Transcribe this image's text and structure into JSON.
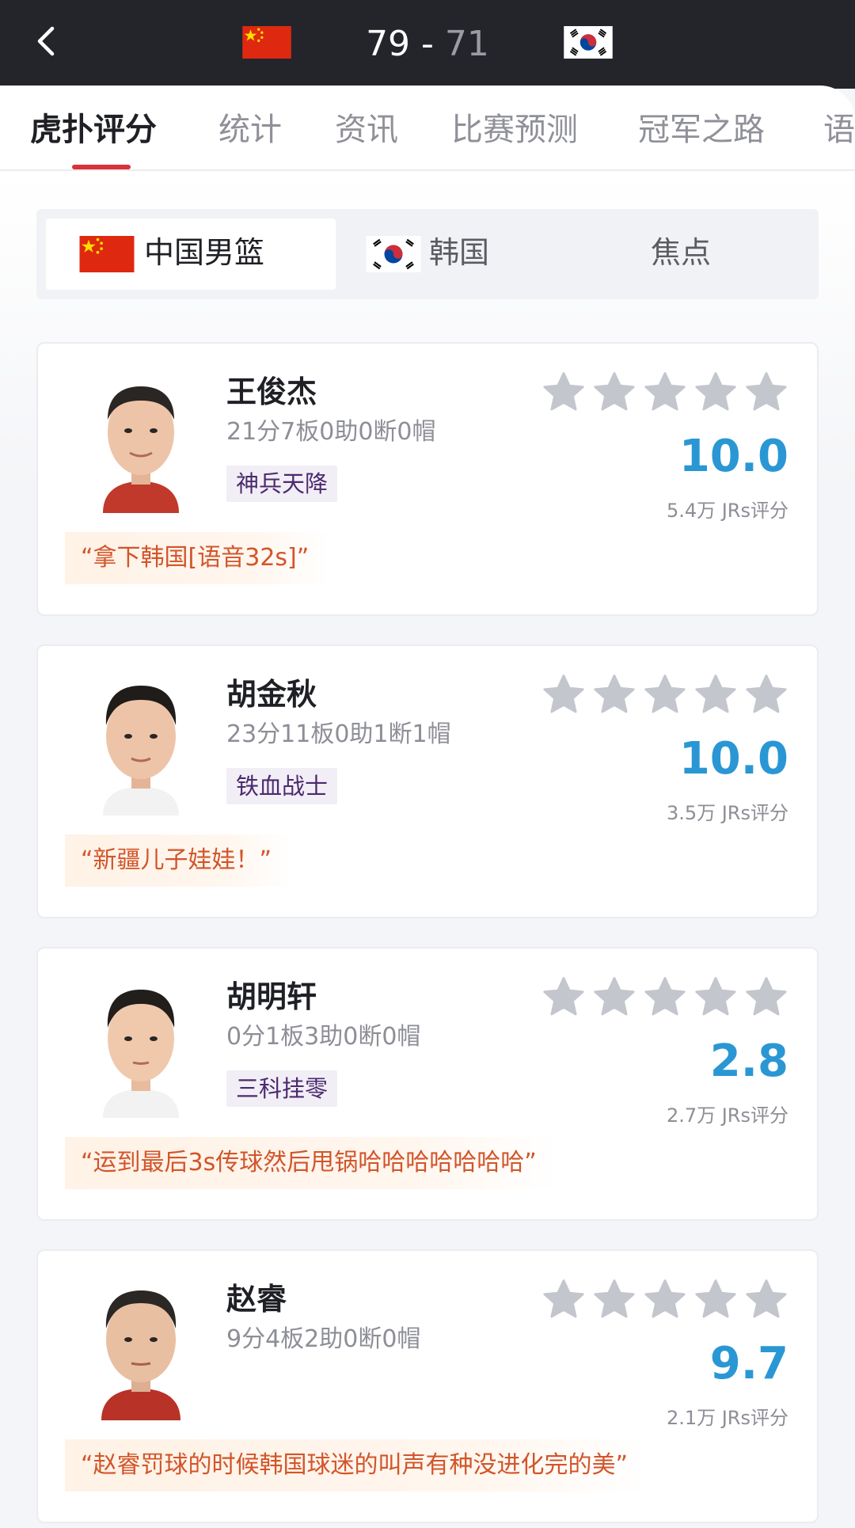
{
  "header": {
    "score_home": "79",
    "score_sep": " - ",
    "score_away": "71",
    "home_flag": "china-flag",
    "away_flag": "south-korea-flag"
  },
  "tabs": [
    {
      "label": "虎扑评分",
      "active": true
    },
    {
      "label": "统计"
    },
    {
      "label": "资讯"
    },
    {
      "label": "比赛预测"
    },
    {
      "label": "冠军之路"
    },
    {
      "label": "语"
    }
  ],
  "segment": {
    "items": [
      {
        "label": "中国男篮",
        "active": true,
        "icon": "china-flag"
      },
      {
        "label": "韩国",
        "icon": "south-korea-flag"
      },
      {
        "label": "焦点"
      }
    ]
  },
  "players": [
    {
      "name": "王俊杰",
      "stats": "21分7板0助0断0帽",
      "badge": "神兵天降",
      "rating": "10.0",
      "votes": "5.4万 JRs评分",
      "quote": "“拿下韩国[语音32s]”"
    },
    {
      "name": "胡金秋",
      "stats": "23分11板0助1断1帽",
      "badge": "铁血战士",
      "rating": "10.0",
      "votes": "3.5万 JRs评分",
      "quote": "“新疆儿子娃娃！”"
    },
    {
      "name": "胡明轩",
      "stats": "0分1板3助0断0帽",
      "badge": "三科挂零",
      "rating": "2.8",
      "votes": "2.7万 JRs评分",
      "quote": "“运到最后3s传球然后甩锅哈哈哈哈哈哈哈”"
    },
    {
      "name": "赵睿",
      "stats": "9分4板2助0断0帽",
      "rating": "9.7",
      "votes": "2.1万 JRs评分",
      "quote": "“赵睿罚球的时候韩国球迷的叫声有种没进化完的美”"
    }
  ],
  "colors": {
    "header_bg": "#24252b",
    "accent_red": "#d9323a",
    "rating_blue": "#2a97d4",
    "quote_orange": "#d2552a",
    "star_gray": "#c4c6ce"
  }
}
